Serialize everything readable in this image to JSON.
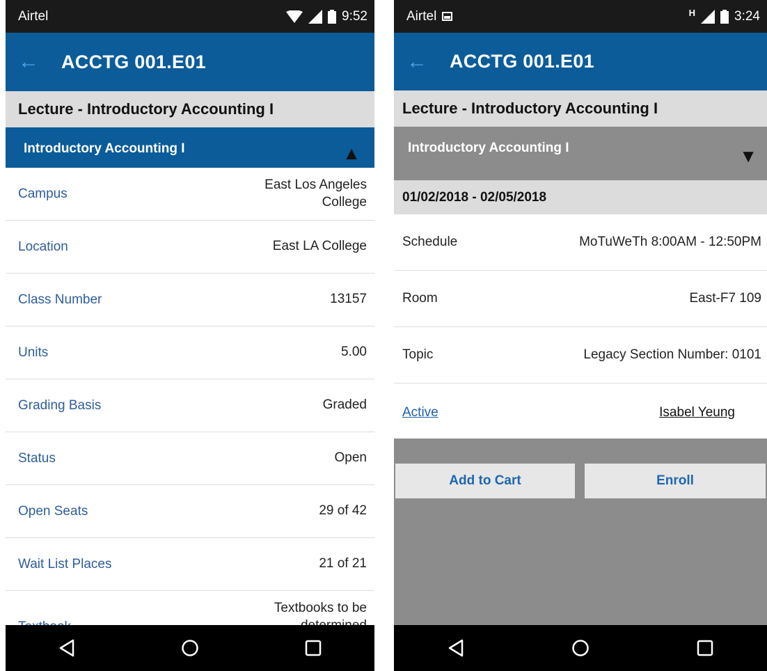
{
  "left": {
    "status": {
      "carrier": "Airtel",
      "time": "9:52"
    },
    "appbar": {
      "title": "ACCTG 001.E01"
    },
    "section_title": "Lecture - Introductory Accounting I",
    "accordion": {
      "title": "Introductory Accounting I",
      "state": "expanded"
    },
    "rows": [
      {
        "label": "Campus",
        "value_line1": "East Los Angeles",
        "value_line2": "College"
      },
      {
        "label": "Location",
        "value": "East LA College"
      },
      {
        "label": "Class Number",
        "value": "13157"
      },
      {
        "label": "Units",
        "value": "5.00"
      },
      {
        "label": "Grading Basis",
        "value": "Graded"
      },
      {
        "label": "Status",
        "value": "Open"
      },
      {
        "label": "Open Seats",
        "value": "29 of 42"
      },
      {
        "label": "Wait List Places",
        "value": "21 of 21"
      },
      {
        "label": "Textbook",
        "value_line1": "Textbooks to be",
        "value_line2": "determined"
      }
    ]
  },
  "right": {
    "status": {
      "carrier": "Airtel",
      "network": "H",
      "time": "3:24"
    },
    "appbar": {
      "title": "ACCTG 001.E01"
    },
    "section_title": "Lecture - Introductory Accounting I",
    "accordion": {
      "title": "Introductory Accounting I",
      "state": "collapsed"
    },
    "date_range": "01/02/2018 - 02/05/2018",
    "rows": [
      {
        "label": "Schedule",
        "value": "MoTuWeTh 8:00AM - 12:50PM"
      },
      {
        "label": "Room",
        "value": "East-F7 109"
      },
      {
        "label": "Topic",
        "value": "Legacy Section Number: 0101"
      }
    ],
    "links": {
      "status": "Active",
      "instructor": "Isabel Yeung"
    },
    "buttons": {
      "add_to_cart": "Add to Cart",
      "enroll": "Enroll"
    }
  },
  "colors": {
    "appbar": "#0b5c99",
    "label_blue": "#2f5d9a",
    "overlay_gray": "#8c8c8c",
    "section_gray": "#dcdcdc"
  },
  "icons": [
    "back-arrow-icon",
    "wifi-icon",
    "signal-icon",
    "battery-icon",
    "gallery-icon",
    "caret-up-icon",
    "caret-down-icon",
    "nav-back-icon",
    "nav-home-icon",
    "nav-recents-icon"
  ]
}
